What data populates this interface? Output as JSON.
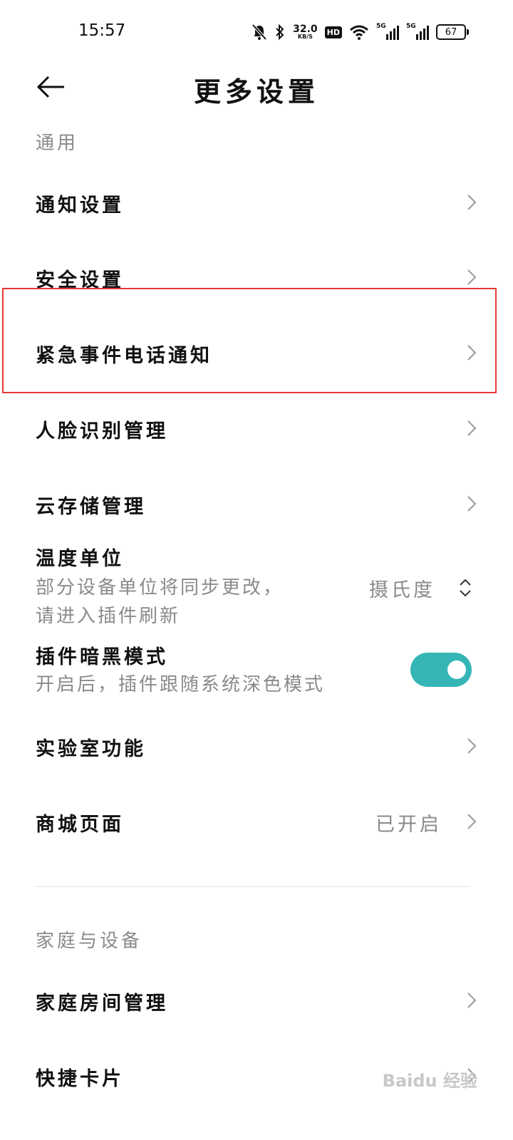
{
  "status_bar": {
    "time": "15:57",
    "speed_value": "32.0",
    "speed_unit": "KB/S",
    "hd_badge": "HD",
    "signal1_label": "5G",
    "signal2_label": "5G",
    "battery": "67"
  },
  "header": {
    "title": "更多设置"
  },
  "sections": {
    "general_label": "通用",
    "family_label": "家庭与设备"
  },
  "items": {
    "notification": "通知设置",
    "security": "安全设置",
    "emergency": "紧急事件电话通知",
    "face": "人脸识别管理",
    "cloud": "云存储管理",
    "temperature": {
      "label": "温度单位",
      "desc_line1": "部分设备单位将同步更改，",
      "desc_line2": "请进入插件刷新",
      "value": "摄氏度"
    },
    "dark_mode": {
      "label": "插件暗黑模式",
      "desc": "开启后，插件跟随系统深色模式",
      "enabled": true
    },
    "lab": "实验室功能",
    "mall": {
      "label": "商城页面",
      "value": "已开启"
    },
    "room": "家庭房间管理",
    "shortcut": "快捷卡片"
  },
  "watermark": "Baidu 经验",
  "colors": {
    "accent": "#35b5b5",
    "highlight": "#e53935",
    "secondary_text": "#8a8a8a"
  }
}
